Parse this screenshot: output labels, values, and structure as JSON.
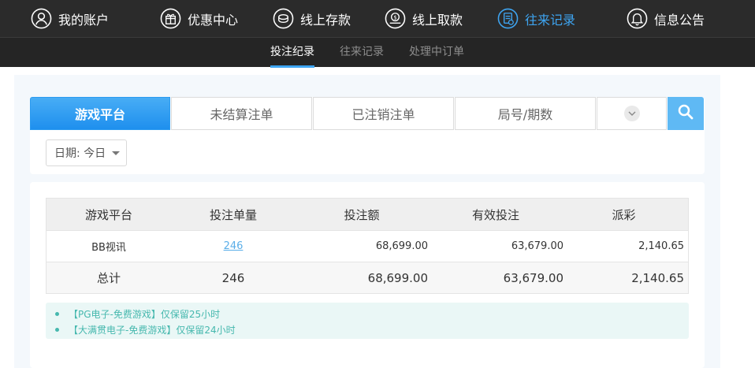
{
  "nav": {
    "items": [
      {
        "label": "我的账户",
        "icon": "user-icon"
      },
      {
        "label": "优惠中心",
        "icon": "gift-icon"
      },
      {
        "label": "线上存款",
        "icon": "deposit-icon"
      },
      {
        "label": "线上取款",
        "icon": "withdraw-icon"
      },
      {
        "label": "往来记录",
        "icon": "records-icon",
        "active": true
      },
      {
        "label": "信息公告",
        "icon": "bell-icon"
      }
    ]
  },
  "subnav": {
    "items": [
      {
        "label": "投注纪录",
        "active": true
      },
      {
        "label": "往来记录"
      },
      {
        "label": "处理中订单"
      }
    ]
  },
  "tabs": {
    "items": [
      "游戏平台",
      "未结算注单",
      "已注销注单",
      "局号/期数"
    ]
  },
  "date_select": {
    "label": "日期: 今日"
  },
  "table": {
    "headers": [
      "游戏平台",
      "投注单量",
      "投注额",
      "有效投注",
      "派彩"
    ],
    "rows": [
      {
        "platform": "BB视讯",
        "count": "246",
        "amount": "68,699.00",
        "valid": "63,679.00",
        "payout": "2,140.65"
      }
    ],
    "total": {
      "label": "总计",
      "count": "246",
      "amount": "68,699.00",
      "valid": "63,679.00",
      "payout": "2,140.65"
    }
  },
  "notices": [
    "【PG电子-免费游戏】仅保留25小时",
    "【大满贯电子-免费游戏】仅保留24小时"
  ],
  "colors": {
    "accent": "#3ea5f2",
    "nav_bg": "#2b2b2b",
    "notice_text": "#46b8ae"
  }
}
